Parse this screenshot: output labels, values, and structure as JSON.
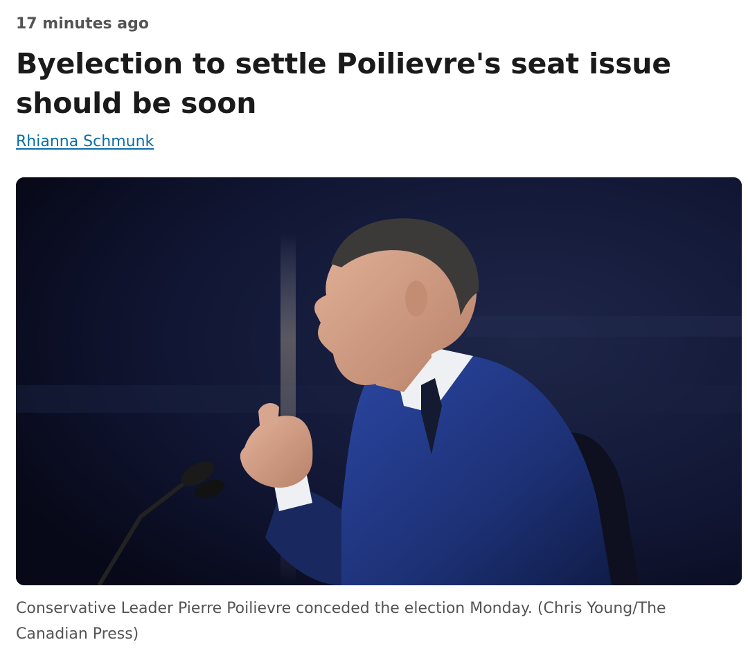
{
  "article": {
    "timestamp": "17 minutes ago",
    "headline": "Byelection to settle Poilievre's seat issue should be soon",
    "author": "Rhianna Schmunk",
    "photo_caption": "Conservative Leader Pierre Poilievre conceded the election Monday. (Chris Young/The Canadian Press)"
  },
  "colors": {
    "text": "#1a1a1a",
    "muted": "#545454",
    "link": "#0a6ea8",
    "photo_background": "#0c1024",
    "suit": "#1f3478"
  }
}
